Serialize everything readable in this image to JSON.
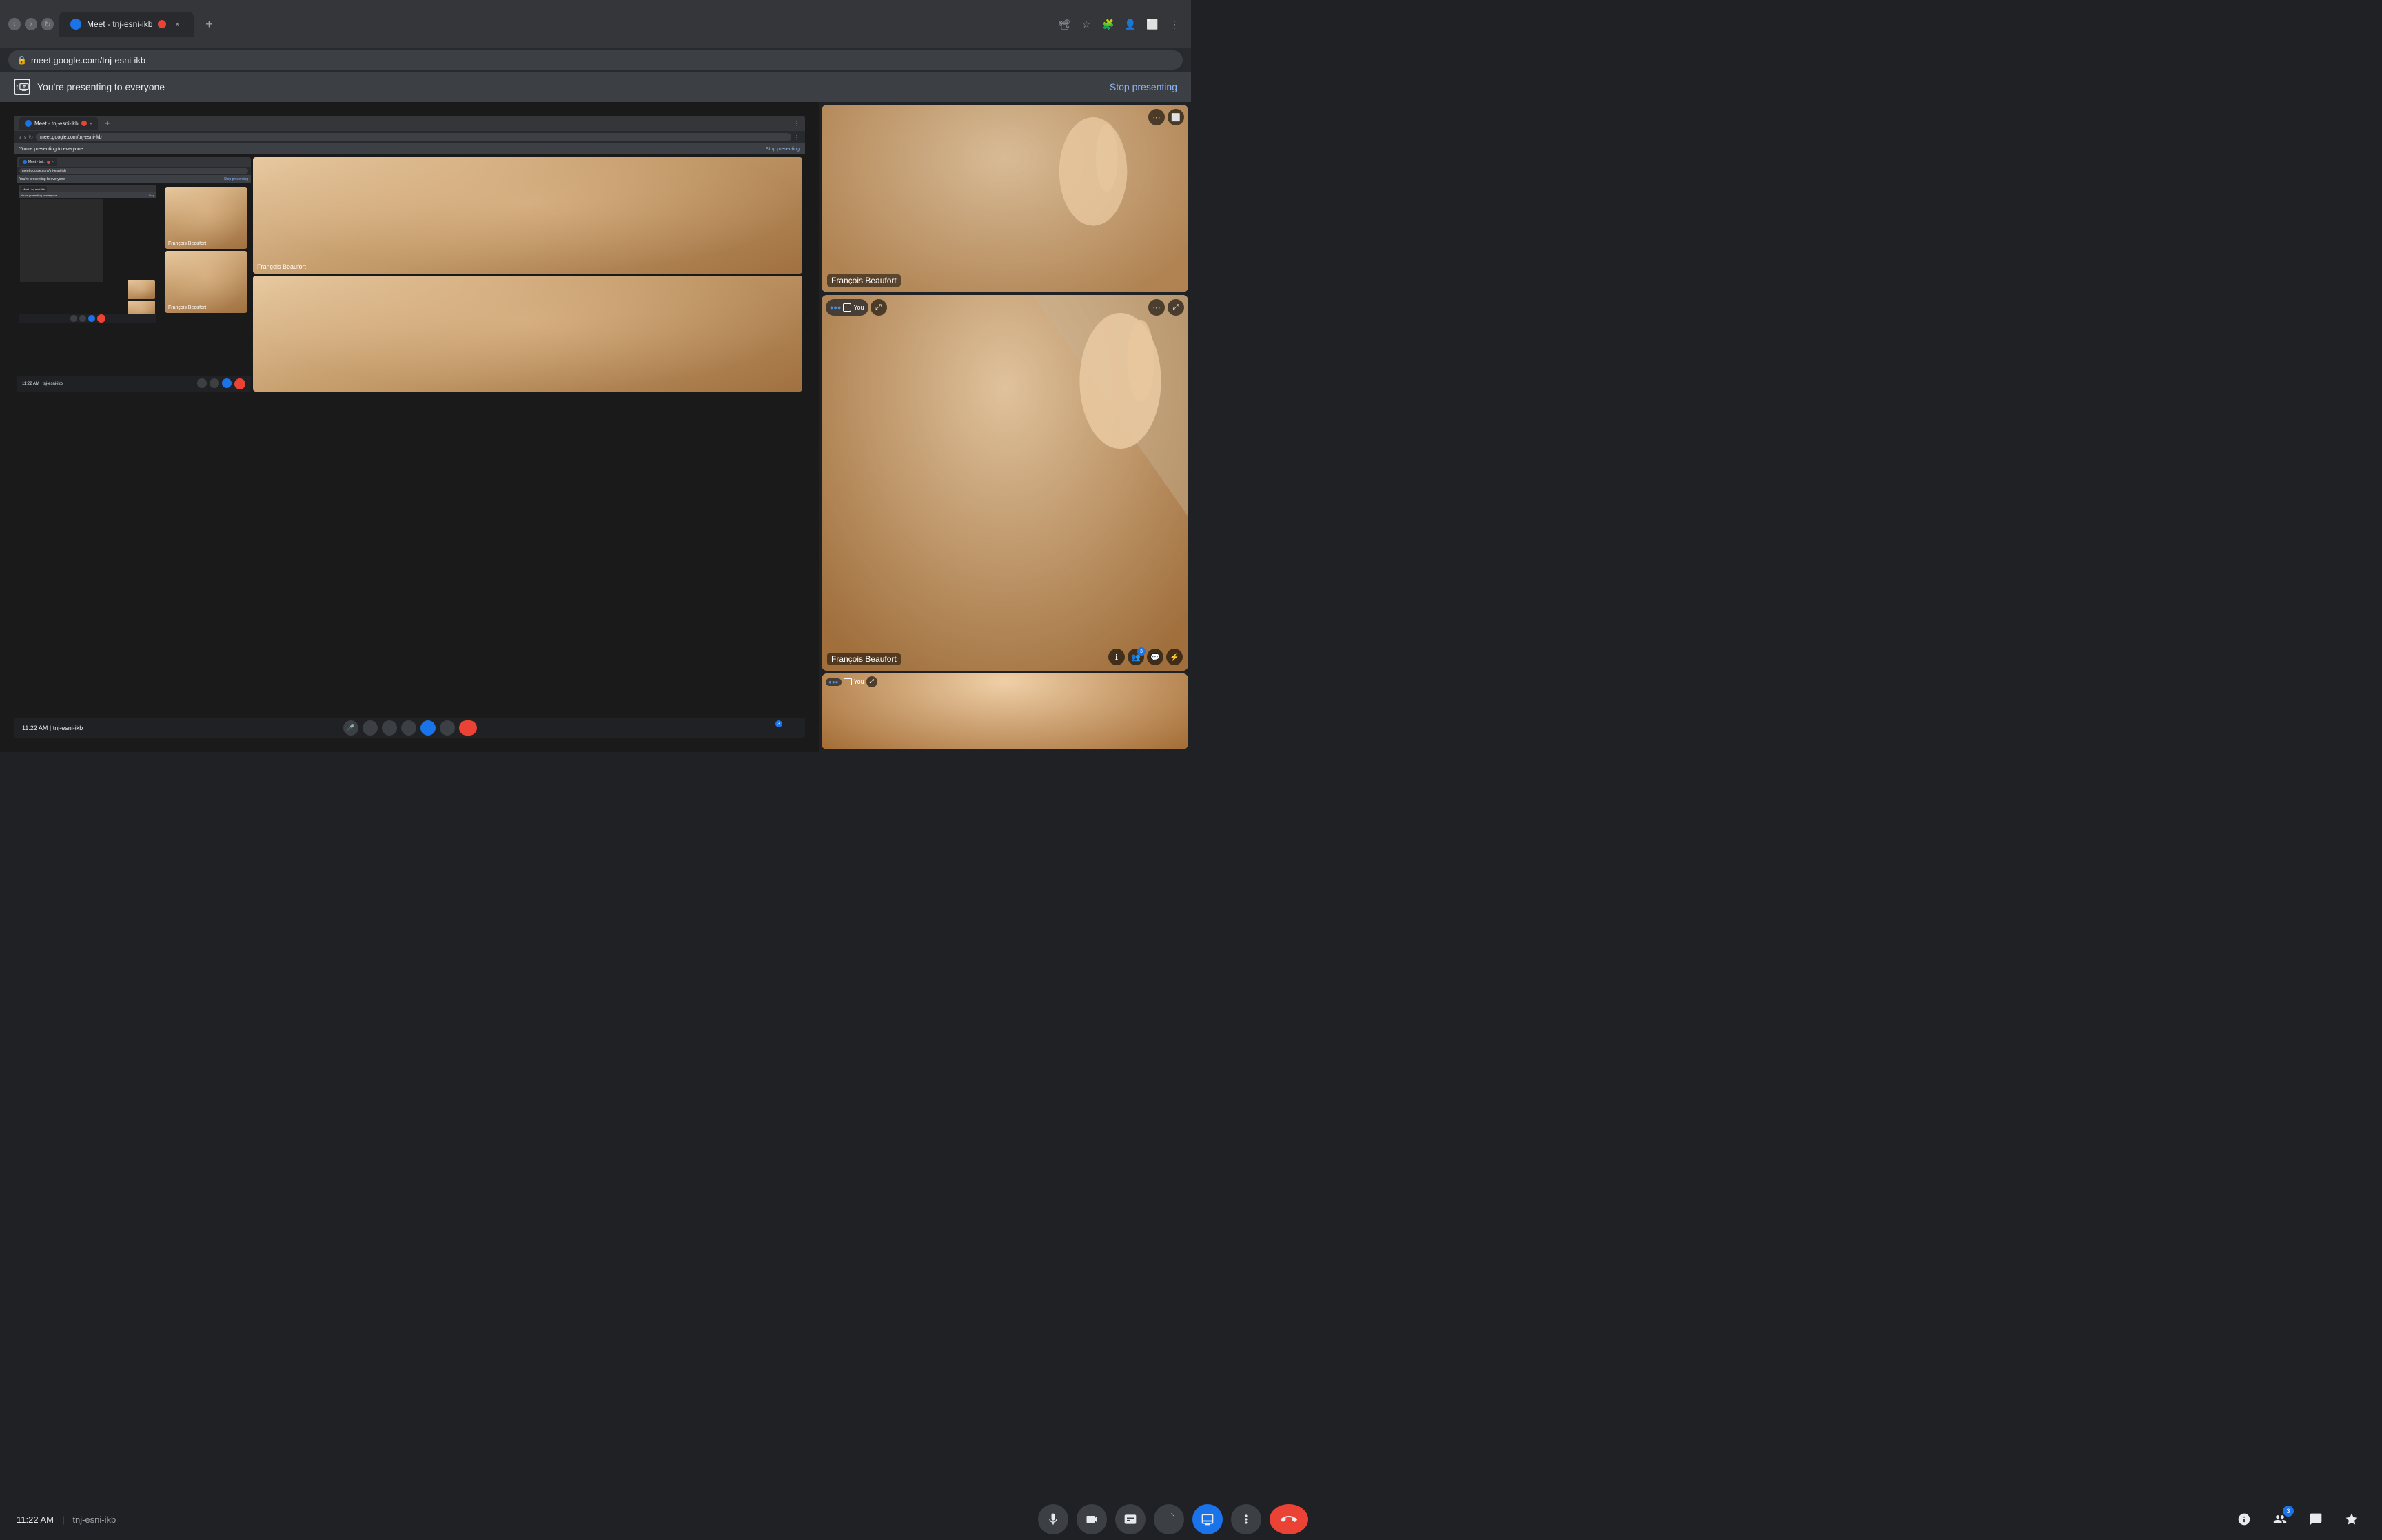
{
  "browser": {
    "tab_title": "Meet - tnj-esni-ikb",
    "url": "meet.google.com/tnj-esni-ikb",
    "new_tab_label": "+",
    "close_label": "×"
  },
  "presentation_banner": {
    "icon_label": "present-icon",
    "message": "You're presenting to everyone",
    "stop_button_label": "Stop presenting"
  },
  "nested_banner": {
    "message": "You're presenting to everyone",
    "stop_label": "Stop presenting"
  },
  "participants": [
    {
      "name": "François Beaufort",
      "id": "francois-1"
    },
    {
      "name": "François Beaufort",
      "id": "francois-2"
    }
  ],
  "self_view": {
    "label": "You"
  },
  "bottom_bar": {
    "time": "11:22 AM",
    "separator": "|",
    "meeting_id": "tnj-esni-ikb",
    "mic_label": "mic",
    "camera_label": "camera",
    "captions_label": "captions",
    "raise_hand_label": "raise hand",
    "present_label": "present",
    "more_label": "more",
    "end_call_label": "end call",
    "info_label": "info",
    "people_label": "people",
    "chat_label": "chat",
    "activities_label": "activities",
    "people_count": "3"
  },
  "nested_address": "meet.google.com/tnj-esni-ikb",
  "deep_nested_address": "meet.google.com/tnj-esni-ikb"
}
